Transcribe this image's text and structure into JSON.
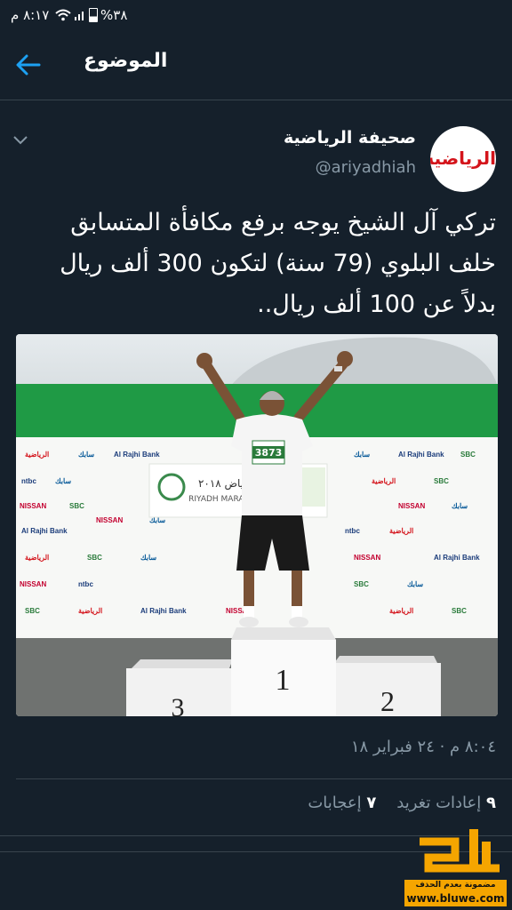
{
  "status_bar": {
    "time": "٨:١٧ م",
    "battery": "٣٨%"
  },
  "header": {
    "title": "الموضوع"
  },
  "tweet": {
    "display_name": "صحيفة الرياضية",
    "handle": "@ariyadhiah",
    "avatar_text": "الرياضية",
    "text_line1": "تركي آل الشيخ يوجه برفع مكافأة المتسابق",
    "text_line2": "خلف البلوي (79 سنة) لتكون 300 ألف ريال",
    "text_line3": "بدلاً عن 100 ألف ريال..",
    "timestamp": "٨:٠٤ م · ٢٤ فبراير ١٨",
    "retweets_count": "٩",
    "retweets_label": "إعادات تغريد",
    "likes_count": "٧",
    "likes_label": "إعجابات"
  },
  "photo": {
    "bib_number": "3873",
    "podium_1": "1",
    "podium_2": "2",
    "podium_3": "3",
    "banner_event": "ماراثون الرياض ٢٠١٨",
    "banner_event_en": "RIYADH MARATHON",
    "sponsor_nissan": "NISSAN",
    "sponsor_rajhi": "Al Rajhi Bank",
    "sponsor_sabic": "سابك",
    "sponsor_riyadhiah": "الرياضية",
    "sponsor_sbc": "SBC",
    "sponsor_ntbc": "ntbc"
  },
  "watermark": {
    "tagline": "مضمونة بعدم الحذف",
    "url": "www.bluwe.com"
  },
  "colors": {
    "background": "#15202b",
    "accent": "#1da1f2",
    "muted": "#8899a6",
    "divider": "#38444d"
  }
}
